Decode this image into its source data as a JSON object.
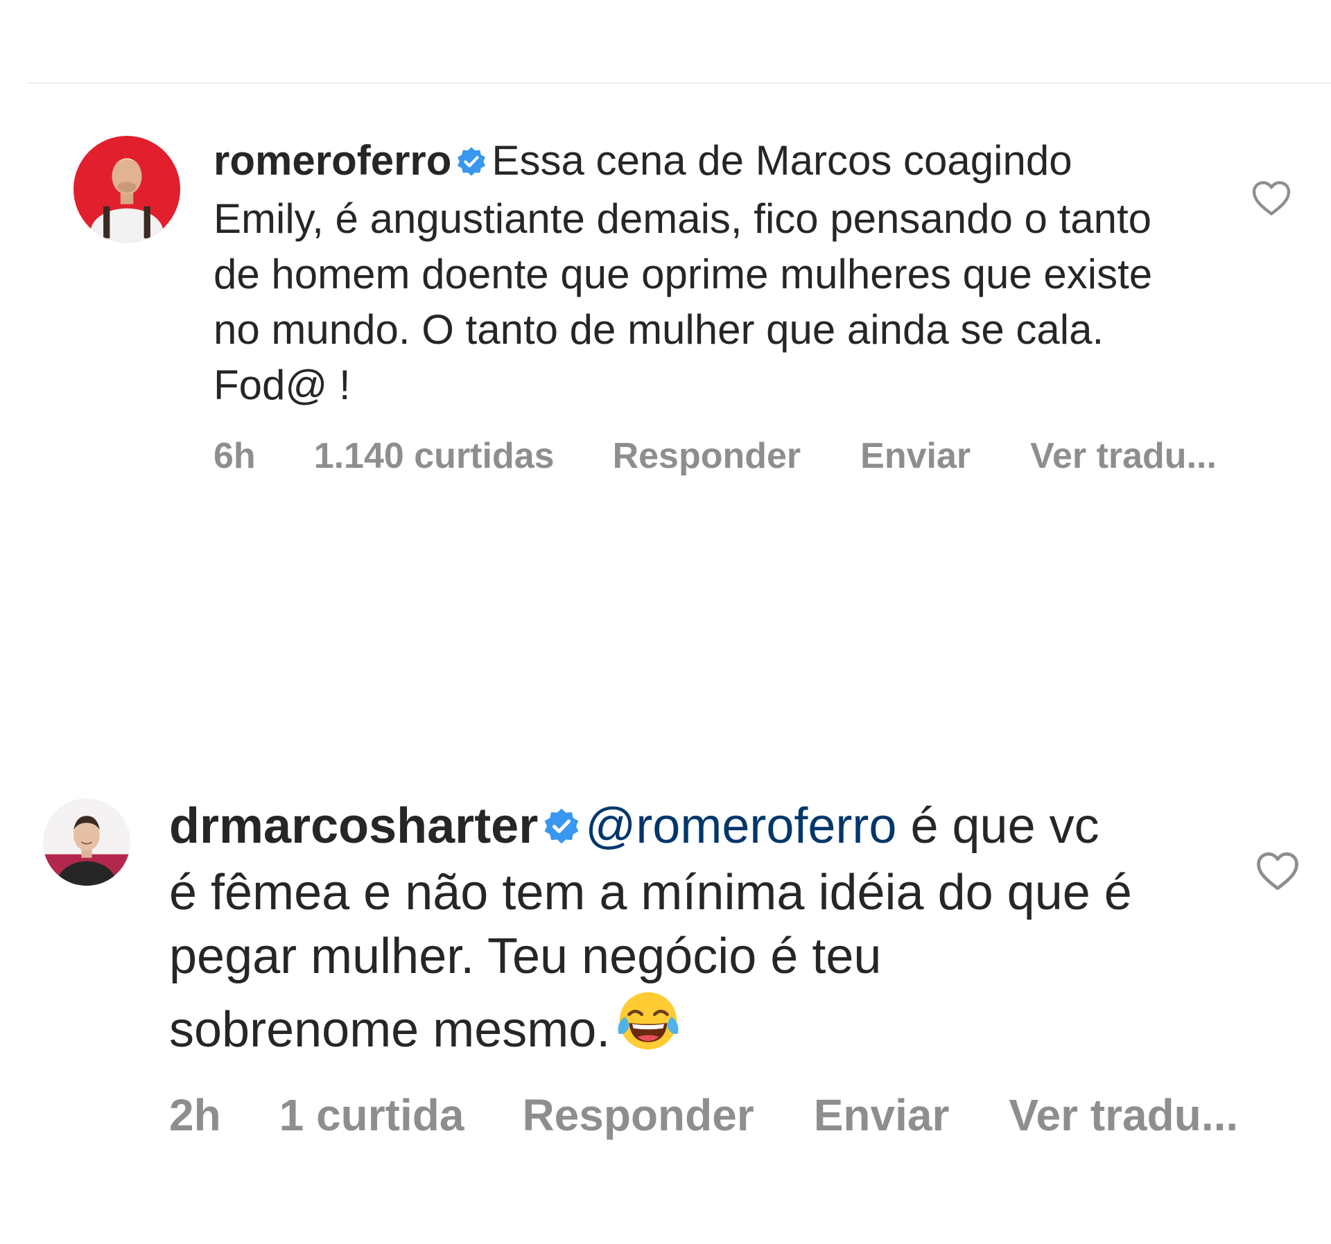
{
  "comments": [
    {
      "username": "romeroferro",
      "verified": true,
      "text": "Essa cena de Marcos coagindo Emily, é angustiante demais, fico pensando o tanto de homem doente que oprime mulheres que existe no mundo. O tanto de mulher que ainda se cala. Fod@ !",
      "time": "6h",
      "likes": "1.140 curtidas",
      "reply": "Responder",
      "send": "Enviar",
      "translate": "Ver tradu..."
    },
    {
      "username": "drmarcosharter",
      "verified": true,
      "mention": "@romeroferro",
      "text": "é que vc é fêmea e não tem a mínima idéia do que é pegar mulher. Teu negócio é teu sobrenome mesmo.",
      "emoji": "face-with-tears-of-joy",
      "time": "2h",
      "likes": "1 curtida",
      "reply": "Responder",
      "send": "Enviar",
      "translate": "Ver tradu..."
    }
  ],
  "colors": {
    "text": "#262626",
    "meta": "#8e8e8e",
    "mention": "#00376b",
    "verified": "#3897f0",
    "divider": "#ececec"
  },
  "icons": [
    "verified-badge-icon",
    "heart-icon",
    "laughing-emoji-icon"
  ]
}
